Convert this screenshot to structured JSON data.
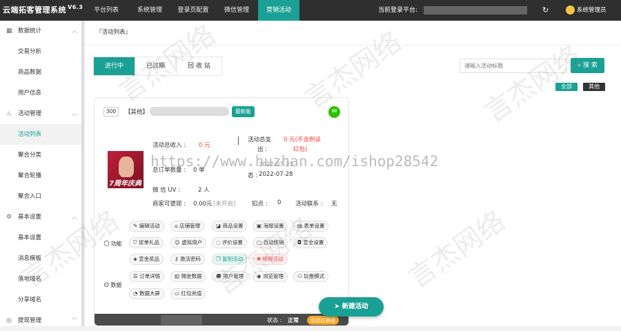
{
  "app": {
    "title": "云端拓客管理系统",
    "version": "V6.3"
  },
  "topnav": [
    "平台列表",
    "系统管理",
    "登录页配置",
    "微信管理",
    "营销活动"
  ],
  "current_platform_label": "当前登录平台:",
  "user_label": "系统管理员",
  "sidebar": [
    {
      "label": "数据统计",
      "type": "group"
    },
    {
      "label": "交易分析"
    },
    {
      "label": "商品数据"
    },
    {
      "label": "用户信息"
    },
    {
      "label": "活动管理",
      "type": "group"
    },
    {
      "label": "活动列表",
      "active": true
    },
    {
      "label": "聚合分类"
    },
    {
      "label": "聚合轮播"
    },
    {
      "label": "聚合入口"
    },
    {
      "label": "基本设置",
      "type": "group"
    },
    {
      "label": "基本设置"
    },
    {
      "label": "消息模板"
    },
    {
      "label": "落地域名"
    },
    {
      "label": "分享域名"
    },
    {
      "label": "提现管理",
      "type": "group"
    }
  ],
  "breadcrumb": "『活动列表』",
  "tabs": [
    "进行中",
    "已过期",
    "回 收 站"
  ],
  "search": {
    "placeholder": "请输入活动标题",
    "button": "搜 索"
  },
  "filter": {
    "all": "全部",
    "other": "其他"
  },
  "card": {
    "badge": "300",
    "category": "【其他】",
    "newtag": "最新版",
    "poster_text": "7周年庆典",
    "income_label": "活动总收入 :",
    "income_value": "0 元",
    "expense_label": "活动总支",
    "expense_label2": "出 :",
    "expense_value": "0 元(不含例读",
    "expense_value2": "红包)",
    "orders_label": "总订单数量 :",
    "orders_value": "0 单",
    "start_fragment": "2022-07-23",
    "end_label": "态 :",
    "end_value": "2022-07-28",
    "wechat_uv_label": "微 信 UV :",
    "wechat_uv_value": "2 人",
    "merchant_label": "商家可提现 :",
    "merchant_value": "0.00元",
    "merchant_status": "[未开启]",
    "deduct_label": "扣点 :",
    "deduct_value": "0",
    "contact_label": "活动联系 :",
    "contact_value": "无",
    "func_label": "功能",
    "data_label": "数据",
    "func_buttons": [
      "编辑活动",
      "店铺管理",
      "商品设置",
      "海报设置",
      "表单设置",
      "促单礼品",
      "虚拟用户",
      "评价设置",
      "自动核销",
      "宣全设置",
      "宣金奖品",
      "激活密码",
      "复制活动",
      "移除活动"
    ],
    "data_buttons": [
      "订单详情",
      "佣金数据",
      "用户管理",
      "浏览管理",
      "玩推模式",
      "数据大屏",
      "红包充值"
    ],
    "status_label": "状态 :",
    "status_value": "正常",
    "expire_label": "活动过期者"
  },
  "new_activity": "新建活动",
  "watermark_url": "https://www.huzhan.com/ishop28542",
  "watermark_text": "言杰网络"
}
